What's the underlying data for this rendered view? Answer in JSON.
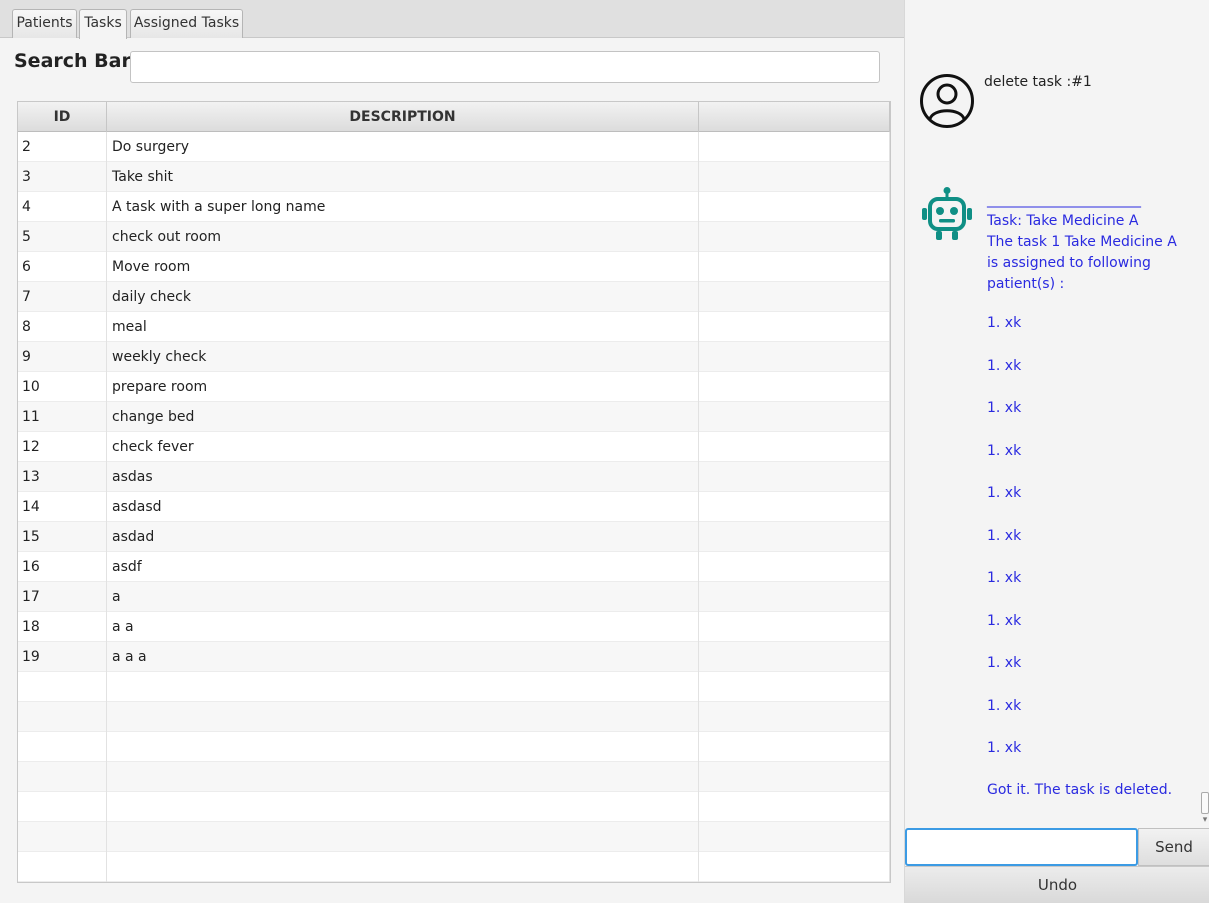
{
  "tabs": [
    {
      "label": "Patients"
    },
    {
      "label": "Tasks"
    },
    {
      "label": "Assigned Tasks"
    }
  ],
  "active_tab": "Tasks",
  "search": {
    "label": "Search Bar",
    "value": ""
  },
  "table": {
    "headers": [
      "ID",
      "DESCRIPTION",
      ""
    ],
    "rows": [
      {
        "id": "2",
        "description": "Do surgery"
      },
      {
        "id": "3",
        "description": "Take shit"
      },
      {
        "id": "4",
        "description": "A task with a super long name"
      },
      {
        "id": "5",
        "description": "check out room"
      },
      {
        "id": "6",
        "description": "Move room"
      },
      {
        "id": "7",
        "description": "daily check"
      },
      {
        "id": "8",
        "description": "meal"
      },
      {
        "id": "9",
        "description": "weekly check"
      },
      {
        "id": "10",
        "description": "prepare room"
      },
      {
        "id": "11",
        "description": "change bed"
      },
      {
        "id": "12",
        "description": "check fever"
      },
      {
        "id": "13",
        "description": "asdas"
      },
      {
        "id": "14",
        "description": "asdasd"
      },
      {
        "id": "15",
        "description": "asdad"
      },
      {
        "id": "16",
        "description": "asdf"
      },
      {
        "id": "17",
        "description": "a"
      },
      {
        "id": "18",
        "description": "a a"
      },
      {
        "id": "19",
        "description": "a a a"
      },
      {
        "id": "",
        "description": ""
      },
      {
        "id": "",
        "description": ""
      },
      {
        "id": "",
        "description": ""
      },
      {
        "id": "",
        "description": ""
      },
      {
        "id": "",
        "description": ""
      },
      {
        "id": "",
        "description": ""
      },
      {
        "id": "",
        "description": ""
      }
    ]
  },
  "chat": {
    "user_message": "delete task :#1",
    "bot_header_lines": [
      "______________________",
      "Task: Take Medicine A",
      "The task 1 Take Medicine A",
      "is assigned to following",
      "patient(s) :"
    ],
    "bot_items": [
      "1. xk",
      "1. xk",
      "1. xk",
      "1. xk",
      "1. xk",
      "1. xk",
      "1. xk",
      "1. xk",
      "1. xk",
      "1. xk",
      "1. xk"
    ],
    "bot_footer": "Got it. The task is deleted.",
    "input_value": "",
    "send_label": "Send",
    "undo_label": "Undo"
  },
  "colors": {
    "bot_text": "#2a2ae0",
    "bot_icon": "#0f8f85",
    "input_focus": "#3c9be4"
  }
}
